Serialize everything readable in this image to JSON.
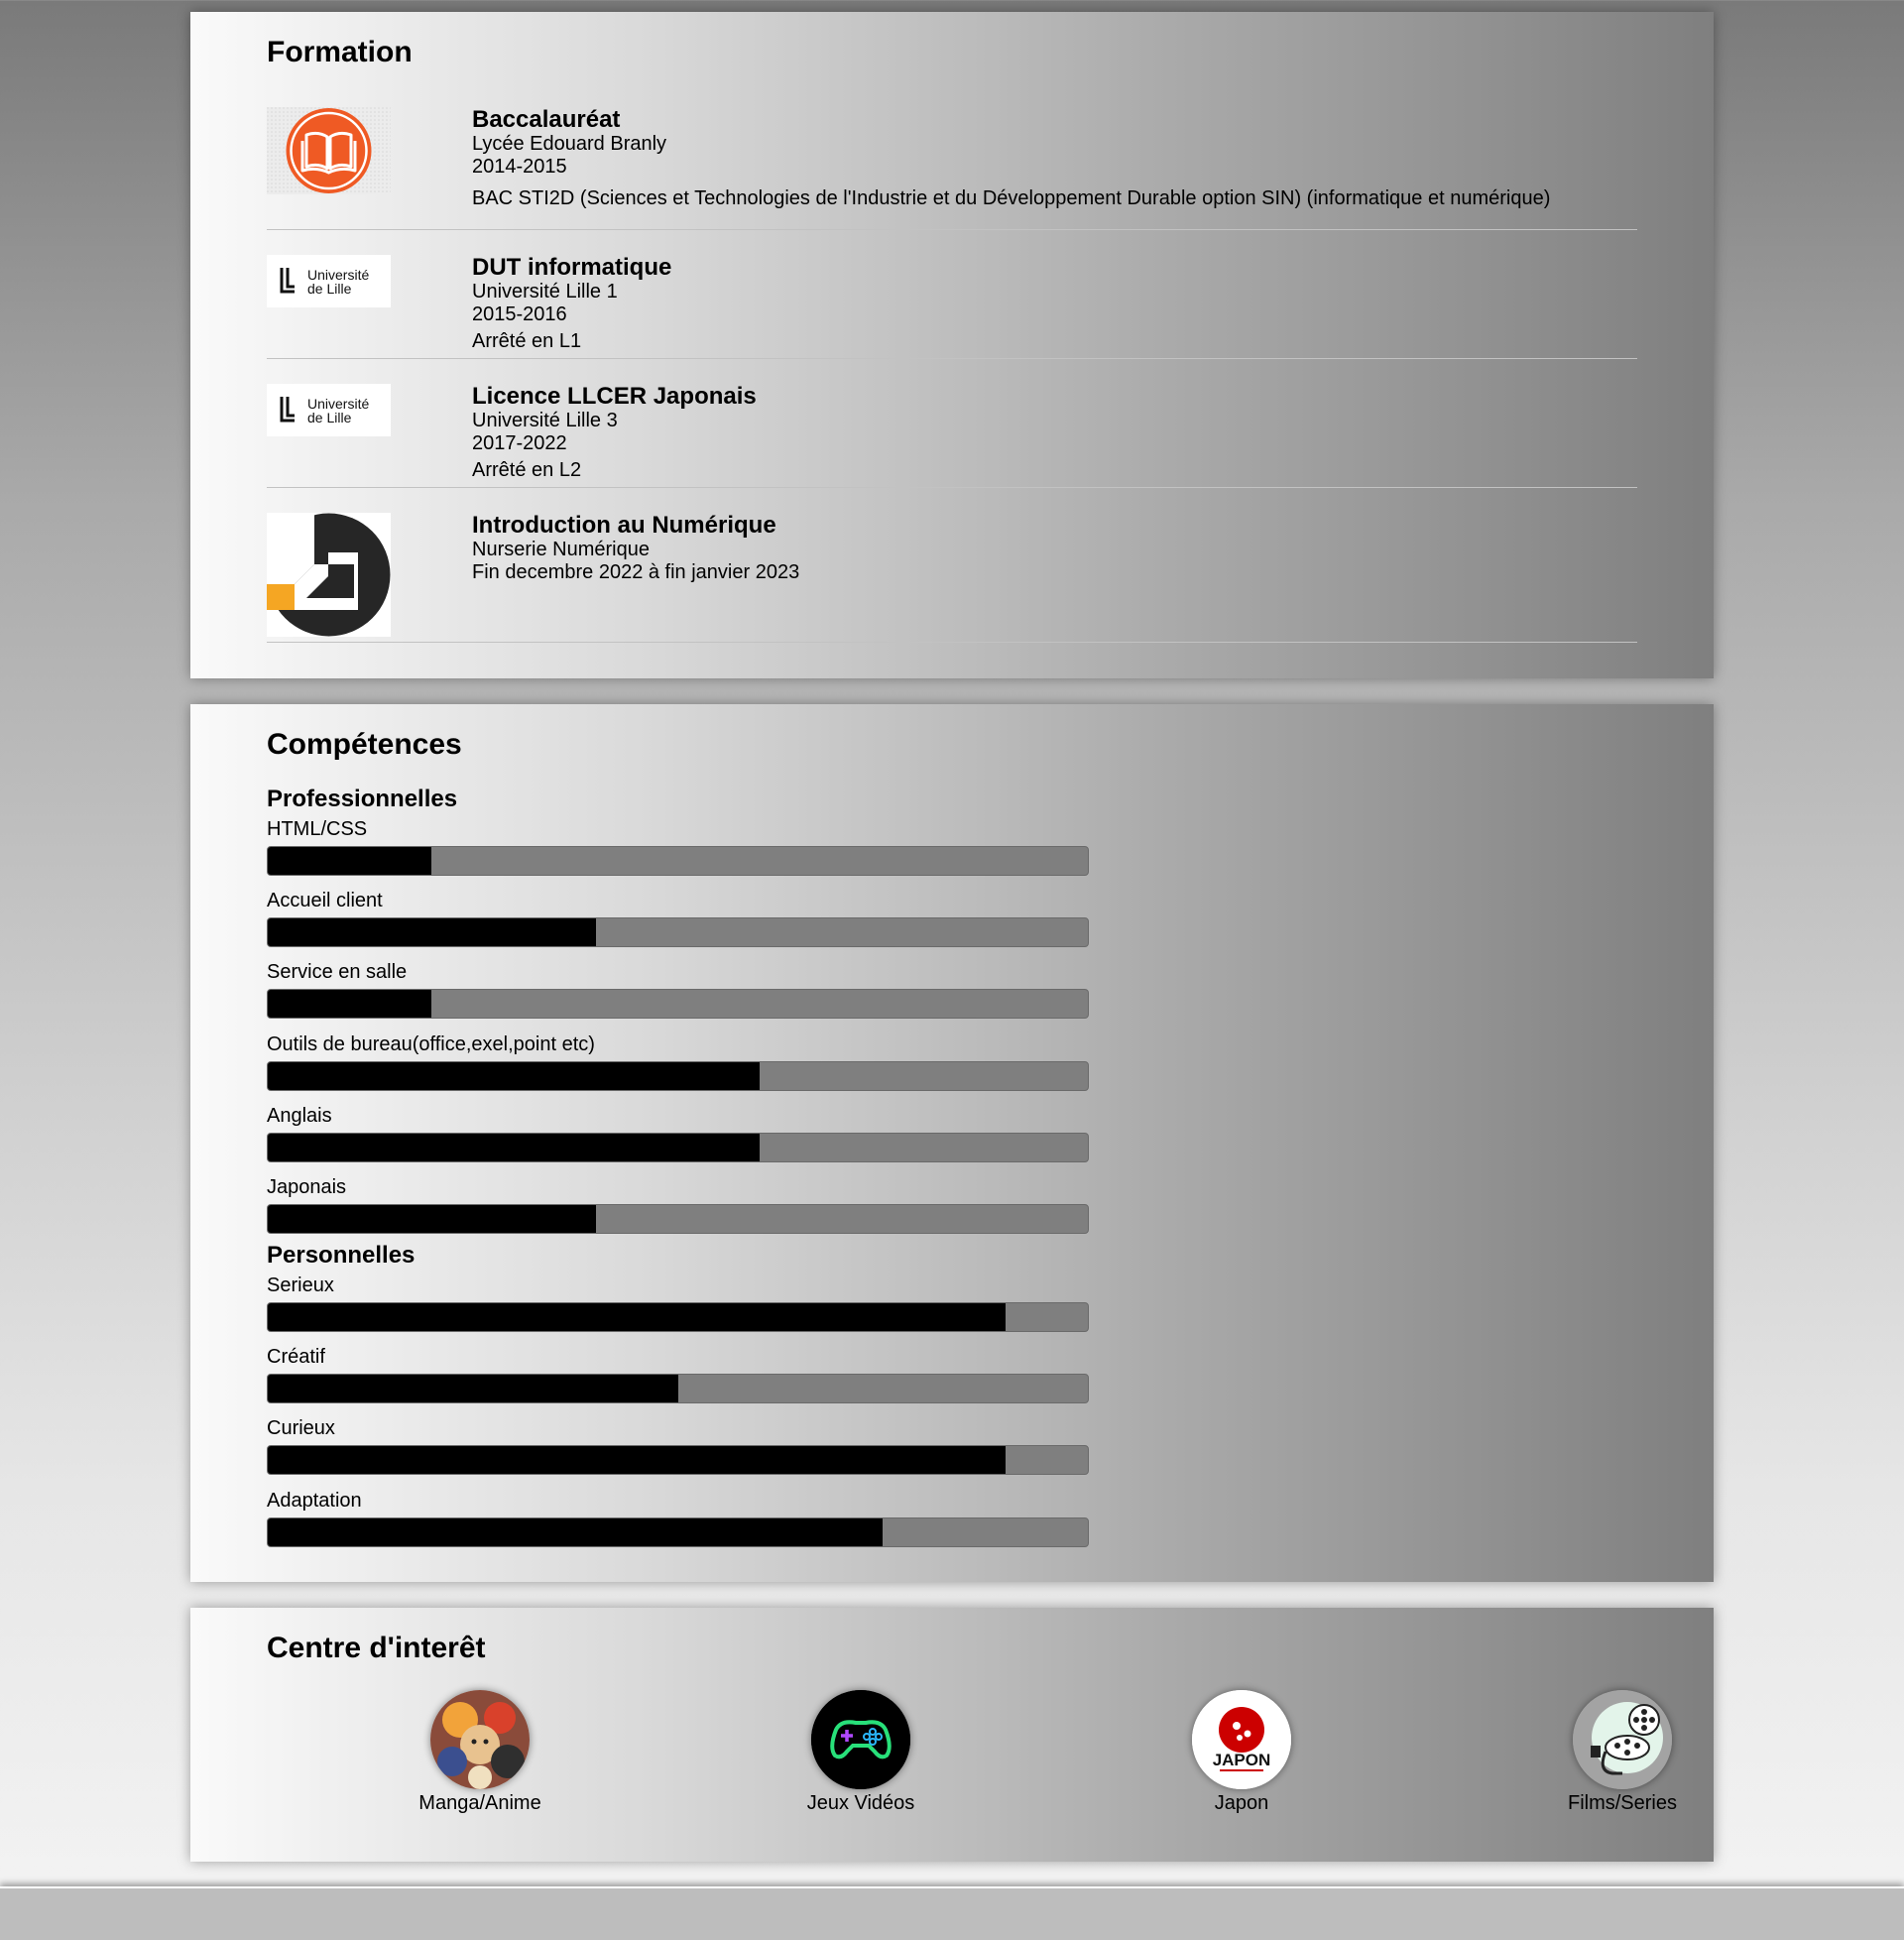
{
  "formation": {
    "title": "Formation",
    "items": [
      {
        "degree": "Baccalauréat",
        "school": "Lycée Edouard Branly",
        "dates": "2014-2015",
        "description": "BAC STI2D (Sciences et Technologies de l'Industrie et du Développement Durable option SIN) (informatique et numérique)",
        "logo": "book-icon",
        "accent": "#ef5a24"
      },
      {
        "degree": "DUT informatique",
        "school": "Université Lille 1",
        "dates": "2015-2016",
        "description": "Arrêté en L1",
        "logo": "universite-de-lille-logo",
        "logo_text": [
          "Université",
          "de Lille"
        ]
      },
      {
        "degree": "Licence LLCER Japonais",
        "school": "Université Lille 3",
        "dates": "2017-2022",
        "description": "Arrêté en L2",
        "logo": "universite-de-lille-logo",
        "logo_text": [
          "Université",
          "de Lille"
        ]
      },
      {
        "degree": "Introduction au Numérique",
        "school": "Nurserie Numérique",
        "dates": "Fin decembre 2022 à fin janvier 2023",
        "logo": "nurserie-numerique-logo",
        "accent": "#f5a623"
      }
    ]
  },
  "competences": {
    "title": "Compétences",
    "professional_title": "Professionnelles",
    "personal_title": "Personnelles",
    "professional": [
      {
        "name": "HTML/CSS",
        "level": 0.2
      },
      {
        "name": "Accueil client",
        "level": 0.4
      },
      {
        "name": "Service en salle",
        "level": 0.2
      },
      {
        "name": "Outils de bureau(office,exel,point etc)",
        "level": 0.6
      },
      {
        "name": "Anglais",
        "level": 0.6
      },
      {
        "name": "Japonais",
        "level": 0.4
      }
    ],
    "personal": [
      {
        "name": "Serieux",
        "level": 0.9
      },
      {
        "name": "Créatif",
        "level": 0.5
      },
      {
        "name": "Curieux",
        "level": 0.9
      },
      {
        "name": "Adaptation",
        "level": 0.75
      }
    ]
  },
  "interets": {
    "title": "Centre d'interêt",
    "items": [
      {
        "label": "Manga/Anime",
        "icon": "manga-anime-icon"
      },
      {
        "label": "Jeux Vidéos",
        "icon": "gamepad-icon"
      },
      {
        "label": "Japon",
        "icon": "japan-flag-icon",
        "badge_text": "JAPON",
        "accent": "#cc0000"
      },
      {
        "label": "Films/Series",
        "icon": "film-reel-icon"
      }
    ]
  }
}
